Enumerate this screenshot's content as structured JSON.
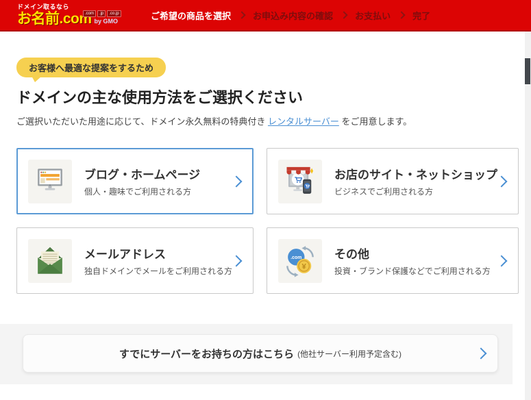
{
  "header": {
    "logo": {
      "tagline": "ドメイン取るなら",
      "brand": "お名前.com",
      "badges": [
        ".com",
        ".jp",
        ".co.jp"
      ],
      "suffix": "by GMO"
    },
    "steps": [
      {
        "label": "ご希望の商品を選択",
        "active": true
      },
      {
        "label": "お申込み内容の確認",
        "active": false
      },
      {
        "label": "お支払い",
        "active": false
      },
      {
        "label": "完了",
        "active": false
      }
    ]
  },
  "main": {
    "badge": "お客様へ最適な提案をするため",
    "title": "ドメインの主な使用方法をご選択ください",
    "description": {
      "before": "ご選択いただいた用途に応じて、ドメイン永久無料の特典付き ",
      "link": "レンタルサーバー",
      "after": " をご用意します。"
    },
    "cards": [
      {
        "title": "ブログ・ホームページ",
        "subtitle": "個人・趣味でご利用される方",
        "icon": "monitor-website-icon",
        "selected": true
      },
      {
        "title": "お店のサイト・ネットショップ",
        "subtitle": "ビジネスでご利用される方",
        "icon": "shop-storefront-icon",
        "selected": false
      },
      {
        "title": "メールアドレス",
        "subtitle": "独自ドメインでメールをご利用される方",
        "icon": "envelope-mail-icon",
        "selected": false
      },
      {
        "title": "その他",
        "subtitle": "投資・ブランド保護などでご利用される方",
        "icon": "domain-exchange-icon",
        "selected": false
      }
    ],
    "server_bar": {
      "label": "すでにサーバーをお持ちの方はこちら",
      "note": "(他社サーバー利用予定含む)"
    }
  },
  "icons": {
    "domain_circle_text": ".com",
    "yen_symbol": "¥"
  },
  "colors": {
    "header_red": "#dc0404",
    "brand_yellow": "#ffe100",
    "badge_yellow": "#f6d050",
    "link_blue": "#4a8fd3",
    "selected_border_blue": "#5b9ad5"
  }
}
